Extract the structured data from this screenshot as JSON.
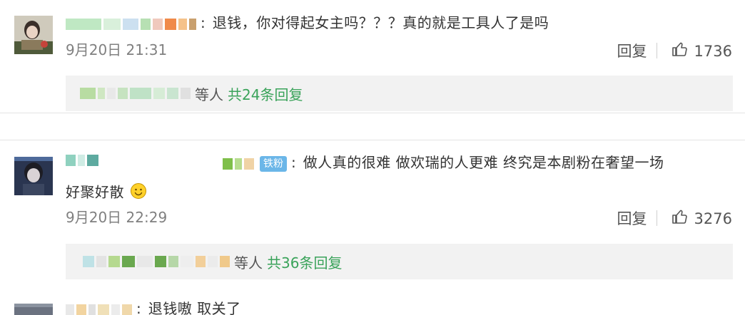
{
  "comments": [
    {
      "text": "退钱，你对得起女主吗？？？真的就是工具人了是吗",
      "time": "9月20日 21:31",
      "reply_label": "回复",
      "likes": "1736",
      "reply_summary": {
        "others": "等人",
        "count": "共24条回复"
      }
    },
    {
      "badge": "铁粉",
      "text_line1": "做人真的很难 做欢瑞的人更难 终究是本剧粉在奢望一场",
      "text_line2": "好聚好散",
      "time": "9月20日 22:29",
      "reply_label": "回复",
      "likes": "3276",
      "reply_summary": {
        "others": "等人",
        "count": "共36条回复"
      }
    },
    {
      "text": "退钱嗷 取关了"
    }
  ],
  "colors": {
    "reply_count": "#3aa35a",
    "badge": "#6bb6e8",
    "time": "#808080"
  }
}
